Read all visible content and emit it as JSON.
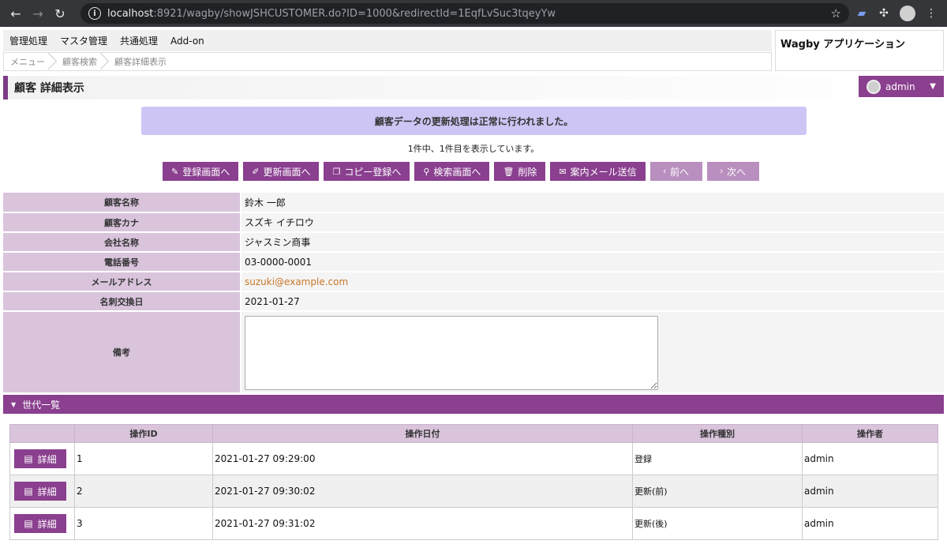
{
  "browser": {
    "url_host": "localhost",
    "url_rest": ":8921/wagby/showJSHCUSTOMER.do?ID=1000&redirectId=1EqfLvSuc3tqeyYw"
  },
  "menu": [
    "管理処理",
    "マスタ管理",
    "共通処理",
    "Add-on"
  ],
  "breadcrumb": [
    "メニュー",
    "顧客検索",
    "顧客詳細表示"
  ],
  "app_title": "Wagby アプリケーション",
  "page_title": "顧客 詳細表示",
  "user": "admin",
  "message": "顧客データの更新処理は正常に行われました。",
  "count_text": "1件中、1件目を表示しています。",
  "actions": [
    {
      "label": "登録画面へ",
      "icon": "✎"
    },
    {
      "label": "更新画面へ",
      "icon": "✐"
    },
    {
      "label": "コピー登録へ",
      "icon": "❐"
    },
    {
      "label": "検索画面へ",
      "icon": "⚲"
    },
    {
      "label": "削除",
      "icon": "🗑"
    },
    {
      "label": "案内メール送信",
      "icon": "✉"
    },
    {
      "label": "前へ",
      "icon": "‹"
    },
    {
      "label": "次へ",
      "icon": "›"
    }
  ],
  "fields": [
    {
      "label": "顧客名称",
      "value": "鈴木 一郎"
    },
    {
      "label": "顧客カナ",
      "value": "スズキ イチロウ"
    },
    {
      "label": "会社名称",
      "value": "ジャスミン商事"
    },
    {
      "label": "電話番号",
      "value": "03-0000-0001"
    },
    {
      "label": "メールアドレス",
      "value": "suzuki@example.com"
    },
    {
      "label": "名刺交換日",
      "value": "2021-01-27"
    },
    {
      "label": "備考",
      "value": ""
    }
  ],
  "generation_title": "世代一覧",
  "history_headers": [
    "",
    "操作ID",
    "操作日付",
    "操作種別",
    "操作者"
  ],
  "history_button": "詳細",
  "history": [
    {
      "id": "1",
      "date": "2021-01-27 09:29:00",
      "type": "登録",
      "user": "admin"
    },
    {
      "id": "2",
      "date": "2021-01-27 09:30:02",
      "type": "更新(前)",
      "user": "admin"
    },
    {
      "id": "3",
      "date": "2021-01-27 09:31:02",
      "type": "更新(後)",
      "user": "admin"
    }
  ]
}
